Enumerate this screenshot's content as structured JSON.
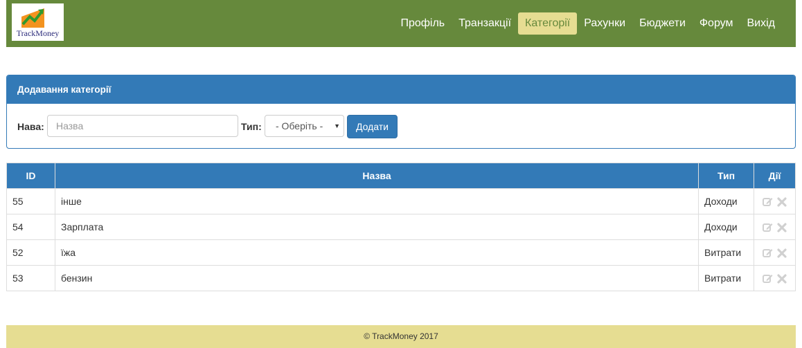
{
  "app": {
    "logo_text": "TrackMoney",
    "colors": {
      "navbar": "#66893c",
      "active_tab": "#e6dd92",
      "primary": "#337ab7",
      "footer": "#e6dd92"
    }
  },
  "nav": {
    "items": [
      {
        "label": "Профіль",
        "active": false
      },
      {
        "label": "Транзакції",
        "active": false
      },
      {
        "label": "Категорії",
        "active": true
      },
      {
        "label": "Рахунки",
        "active": false
      },
      {
        "label": "Бюджети",
        "active": false
      },
      {
        "label": "Форум",
        "active": false
      },
      {
        "label": "Вихід",
        "active": false
      }
    ]
  },
  "add_panel": {
    "title": "Додавання категорії",
    "name_label": "Нава:",
    "name_placeholder": "Назва",
    "type_label": "Тип:",
    "type_selected": "- Оберіть -",
    "submit_label": "Додати"
  },
  "table": {
    "headers": {
      "id": "ID",
      "name": "Назва",
      "type": "Тип",
      "actions": "Дії"
    },
    "rows": [
      {
        "id": "55",
        "name": "інше",
        "type": "Доходи"
      },
      {
        "id": "54",
        "name": "Зарплата",
        "type": "Доходи"
      },
      {
        "id": "52",
        "name": "їжа",
        "type": "Витрати"
      },
      {
        "id": "53",
        "name": "бензин",
        "type": "Витрати"
      }
    ],
    "row_action_icons": [
      "edit-icon",
      "delete-icon"
    ]
  },
  "footer": {
    "text": "© TrackMoney 2017"
  }
}
